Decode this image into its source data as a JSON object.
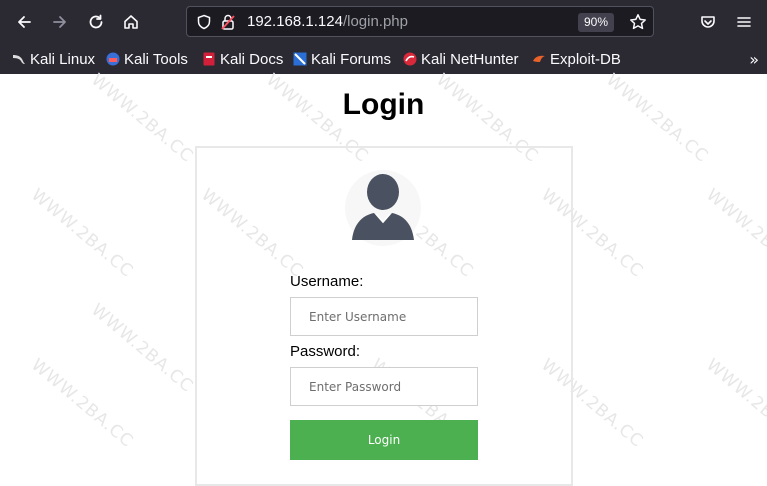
{
  "browser": {
    "url_host": "192.168.1.124",
    "url_path": "/login.php",
    "zoom": "90%",
    "bookmarks": [
      {
        "label": "Kali Linux"
      },
      {
        "label": "Kali Tools"
      },
      {
        "label": "Kali Docs"
      },
      {
        "label": "Kali Forums"
      },
      {
        "label": "Kali NetHunter"
      },
      {
        "label": "Exploit-DB"
      }
    ],
    "overflow_glyph": "»"
  },
  "watermark": "WWW.2BA.CC",
  "page": {
    "title": "Login",
    "username_label": "Username:",
    "username_placeholder": "Enter Username",
    "username_value": "",
    "password_label": "Password:",
    "password_placeholder": "Enter Password",
    "password_value": "",
    "login_button": "Login"
  },
  "colors": {
    "chrome_bg": "#2b2a33",
    "urlbar_bg": "#1c1b22",
    "button_green": "#4caf50",
    "avatar_fill": "#4a5160"
  },
  "icons": [
    "back-arrow-icon",
    "forward-arrow-icon",
    "reload-icon",
    "home-icon",
    "shield-icon",
    "lock-insecure-icon",
    "star-icon",
    "pocket-icon",
    "menu-icon",
    "user-avatar-icon"
  ]
}
